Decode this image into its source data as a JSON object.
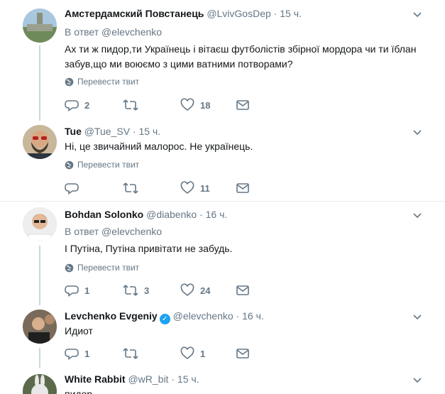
{
  "translate_label": "Перевести твит",
  "tweets": [
    {
      "name": "Амстердамский Повстанець",
      "handle": "@LvivGosDep",
      "time": "15 ч.",
      "reply_to_prefix": "В ответ",
      "reply_to": "@elevchenko",
      "text": "Ах ти ж пидор,ти Українець і вітаєш футболістів збірної мордора чи ти їблан забув,що ми воюємо з цими ватними потворами?",
      "replies": "2",
      "retweets": "",
      "likes": "18"
    },
    {
      "name": "Tue",
      "handle": "@Tue_SV",
      "time": "15 ч.",
      "text": "Ні, це звичайний малорос. Не українець.",
      "replies": "",
      "retweets": "",
      "likes": "11"
    },
    {
      "name": "Bohdan Solonko",
      "handle": "@diabenko",
      "time": "16 ч.",
      "reply_to_prefix": "В ответ",
      "reply_to": "@elevchenko",
      "text": "І Путіна, Путіна привітати не забудь.",
      "replies": "1",
      "retweets": "3",
      "likes": "24"
    },
    {
      "name": "Levchenko Evgeniy",
      "handle": "@elevchenko",
      "time": "16 ч.",
      "text": "Идиот",
      "replies": "1",
      "retweets": "",
      "likes": "1"
    },
    {
      "name": "White Rabbit",
      "handle": "@wR_bit",
      "time": "15 ч.",
      "text": "пидор"
    }
  ],
  "colors": {
    "text": "#14171a",
    "muted": "#657786",
    "verified": "#1da1f2",
    "thread": "#ccd6dd",
    "divider": "#e6ecf0"
  }
}
